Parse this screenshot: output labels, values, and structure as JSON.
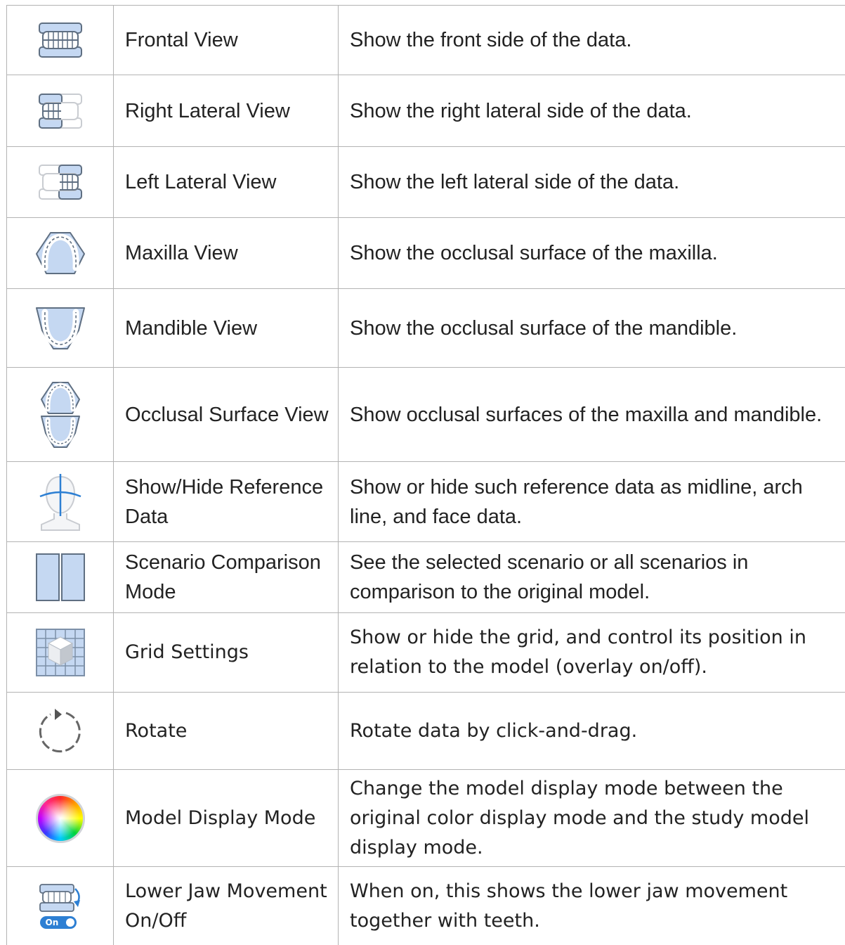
{
  "rows": [
    {
      "icon": "frontal-view-icon",
      "name": "Frontal View",
      "desc": "Show the front side of the data."
    },
    {
      "icon": "right-lateral-view-icon",
      "name": "Right Lateral View",
      "desc": "Show the right lateral side of the data."
    },
    {
      "icon": "left-lateral-view-icon",
      "name": "Left Lateral View",
      "desc": "Show the left lateral side of the data."
    },
    {
      "icon": "maxilla-view-icon",
      "name": "Maxilla View",
      "desc": "Show the occlusal surface of the maxilla."
    },
    {
      "icon": "mandible-view-icon",
      "name": "Mandible View",
      "desc": "Show the occlusal surface of the mandible."
    },
    {
      "icon": "occlusal-surface-view-icon",
      "name": "Occlusal Surface View",
      "desc": "Show occlusal surfaces of the maxilla and mandible."
    },
    {
      "icon": "reference-data-icon",
      "name": "Show/Hide Reference Data",
      "desc": "Show or hide such reference data as midline, arch line, and face data."
    },
    {
      "icon": "scenario-comparison-icon",
      "name": "Scenario Comparison Mode",
      "desc": "See the selected scenario or all scenarios in comparison to the original model."
    },
    {
      "icon": "grid-settings-icon",
      "name": "Grid Settings",
      "desc": "Show or hide the grid, and control its position in relation to the model (overlay on/off)."
    },
    {
      "icon": "rotate-icon",
      "name": "Rotate",
      "desc": "Rotate data by click-and-drag."
    },
    {
      "icon": "color-wheel-icon",
      "name": "Model Display Mode",
      "desc": "Change the model display mode between the original color display mode and the study model display mode."
    },
    {
      "icon": "lower-jaw-movement-icon",
      "name": "Lower Jaw Movement On/Off",
      "desc": "When on, this shows the lower jaw movement together with teeth.",
      "toggle_label": "On"
    }
  ],
  "colors": {
    "border": "#b3b3b3",
    "icon_fill": "#c5d8f2",
    "icon_stroke": "#5f6f82",
    "accent": "#2d7fd3"
  }
}
